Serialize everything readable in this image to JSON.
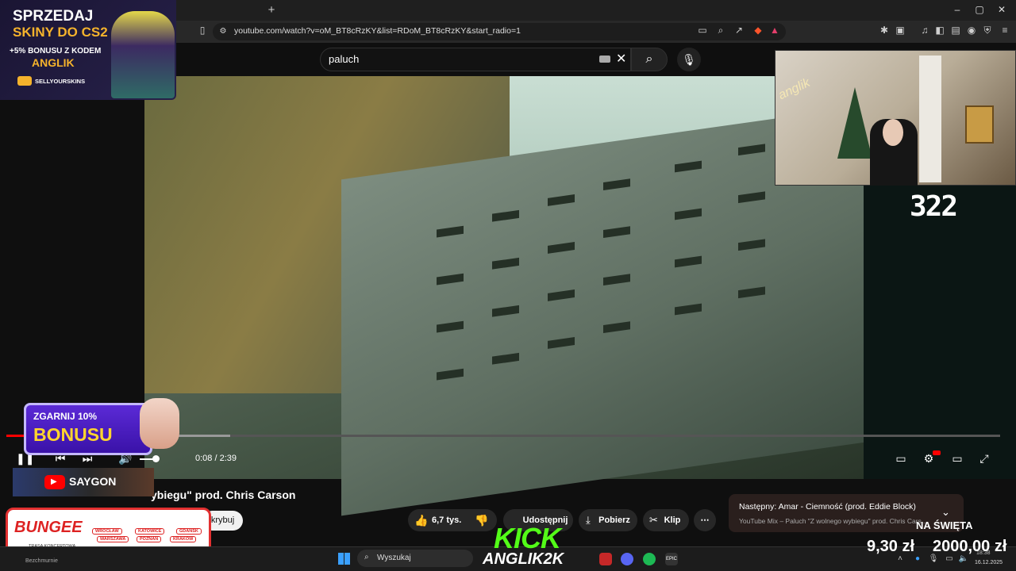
{
  "browser": {
    "new_tab": "+",
    "url": "youtube.com/watch?v=oM_BT8cRzKY&list=RDoM_BT8cRzKY&start_radio=1",
    "window_controls": [
      "–",
      "▢",
      "✕"
    ]
  },
  "youtube": {
    "search_value": "paluch",
    "video": {
      "time": "0:08 / 2:39",
      "progress_fraction": 0.05
    },
    "title_partial": "ybiegu\" prod. Chris Carson",
    "subscribe_partial": "krybuj",
    "actions": {
      "likes": "6,7 tys.",
      "share": "Udostępnij",
      "download": "Pobierz",
      "clip": "Klip",
      "more": "⋯"
    },
    "next_up": {
      "title": "Następny: Amar - Ciemność (prod. Eddie Block)",
      "subtitle": "YouTube Mix – Paluch \"Z wolnego wybiegu\" prod. Chris Cars..."
    }
  },
  "stream_overlay": {
    "counter": "322",
    "ad_top": {
      "line1": "SPRZEDAJ",
      "line2": "SKINY DO CS2",
      "line3": "+5% BONUSU Z KODEM",
      "line4": "ANGLIK",
      "brand": "SELLYOURSKINS"
    },
    "bonus": {
      "line1": "ZGARNIJ 10%",
      "line2": "BONUSU"
    },
    "saygon": "SAYGON",
    "bungee": {
      "title": "BUNGEE",
      "subtitle": "TRASA KONCERTOWA",
      "cities": [
        "WROCŁAW",
        "KATOWICE",
        "GDAŃSK",
        "WARSZAWA",
        "POZNAŃ",
        "KRAKÓW"
      ]
    },
    "kick": "KICK",
    "kick_user": "ANGLIK2K",
    "goal_label": "NA ŚWIĘTA",
    "goal_current": "9,30 zł",
    "goal_target": "2000,00 zł",
    "neon": "anglik"
  },
  "taskbar": {
    "search_placeholder": "Wyszukaj",
    "time": "18:38",
    "date": "16.12.2025",
    "weather_partial": "Bezchmurnie"
  },
  "colors": {
    "youtube_red": "#ff0000",
    "kick_green": "#53fc18",
    "ad_gold": "#f5b32c",
    "bonus_purple": "#4a1fc0"
  }
}
